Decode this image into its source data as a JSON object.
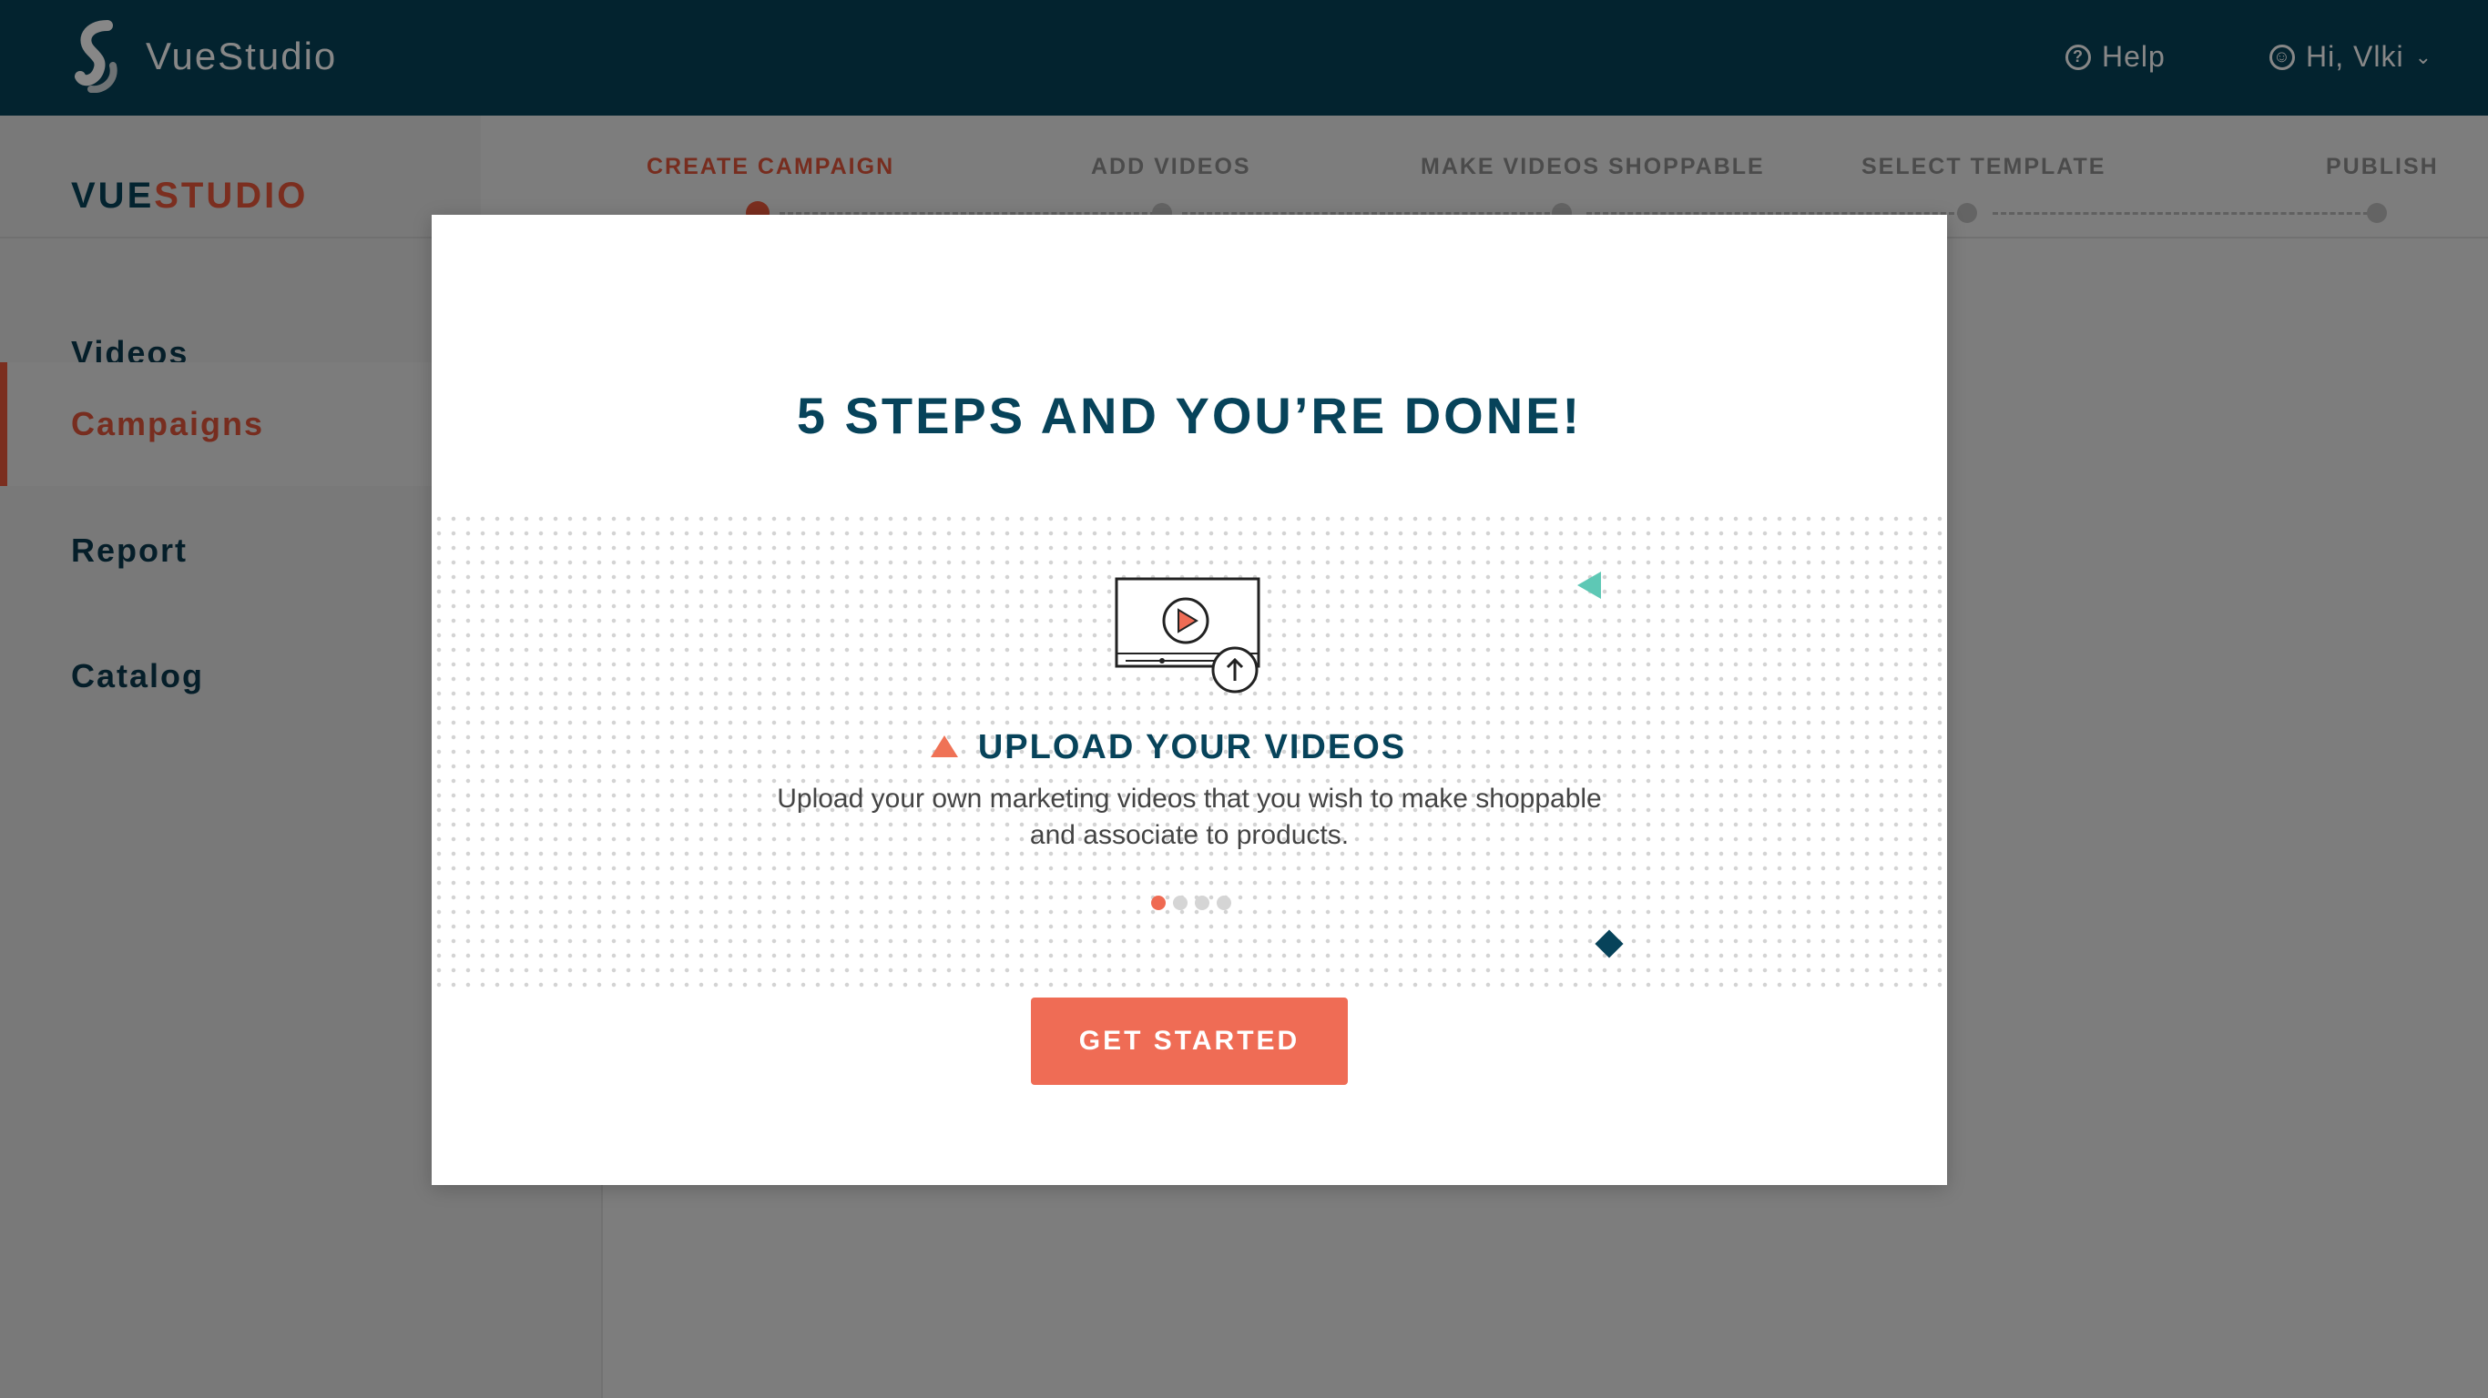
{
  "app": {
    "brand": "VueStudio"
  },
  "header": {
    "help_label": "Help",
    "user_label": "Hi, Vlki"
  },
  "sidebar": {
    "brand_part1": "VUE",
    "brand_part2": "STUDIO",
    "items": [
      {
        "label": "Videos",
        "active": false
      },
      {
        "label": "Campaigns",
        "active": true
      },
      {
        "label": "Report",
        "active": false
      },
      {
        "label": "Catalog",
        "active": false
      }
    ]
  },
  "stepper": {
    "steps": [
      {
        "label": "CREATE CAMPAIGN",
        "active": true
      },
      {
        "label": "ADD VIDEOS",
        "active": false
      },
      {
        "label": "MAKE VIDEOS SHOPPABLE",
        "active": false
      },
      {
        "label": "SELECT TEMPLATE",
        "active": false
      },
      {
        "label": "PUBLISH",
        "active": false
      }
    ]
  },
  "modal": {
    "title": "5 STEPS AND YOU’RE DONE!",
    "slide_heading": "UPLOAD YOUR VIDEOS",
    "slide_desc_line1": "Upload your own marketing videos that you wish to make shoppable",
    "slide_desc_line2": "and associate to products.",
    "pager_total": 4,
    "pager_current": 1,
    "cta_label": "GET STARTED"
  },
  "colors": {
    "header_bg": "#07435a",
    "accent": "#e8573c",
    "cta": "#ef6c55",
    "teal": "#5ec8b5"
  }
}
